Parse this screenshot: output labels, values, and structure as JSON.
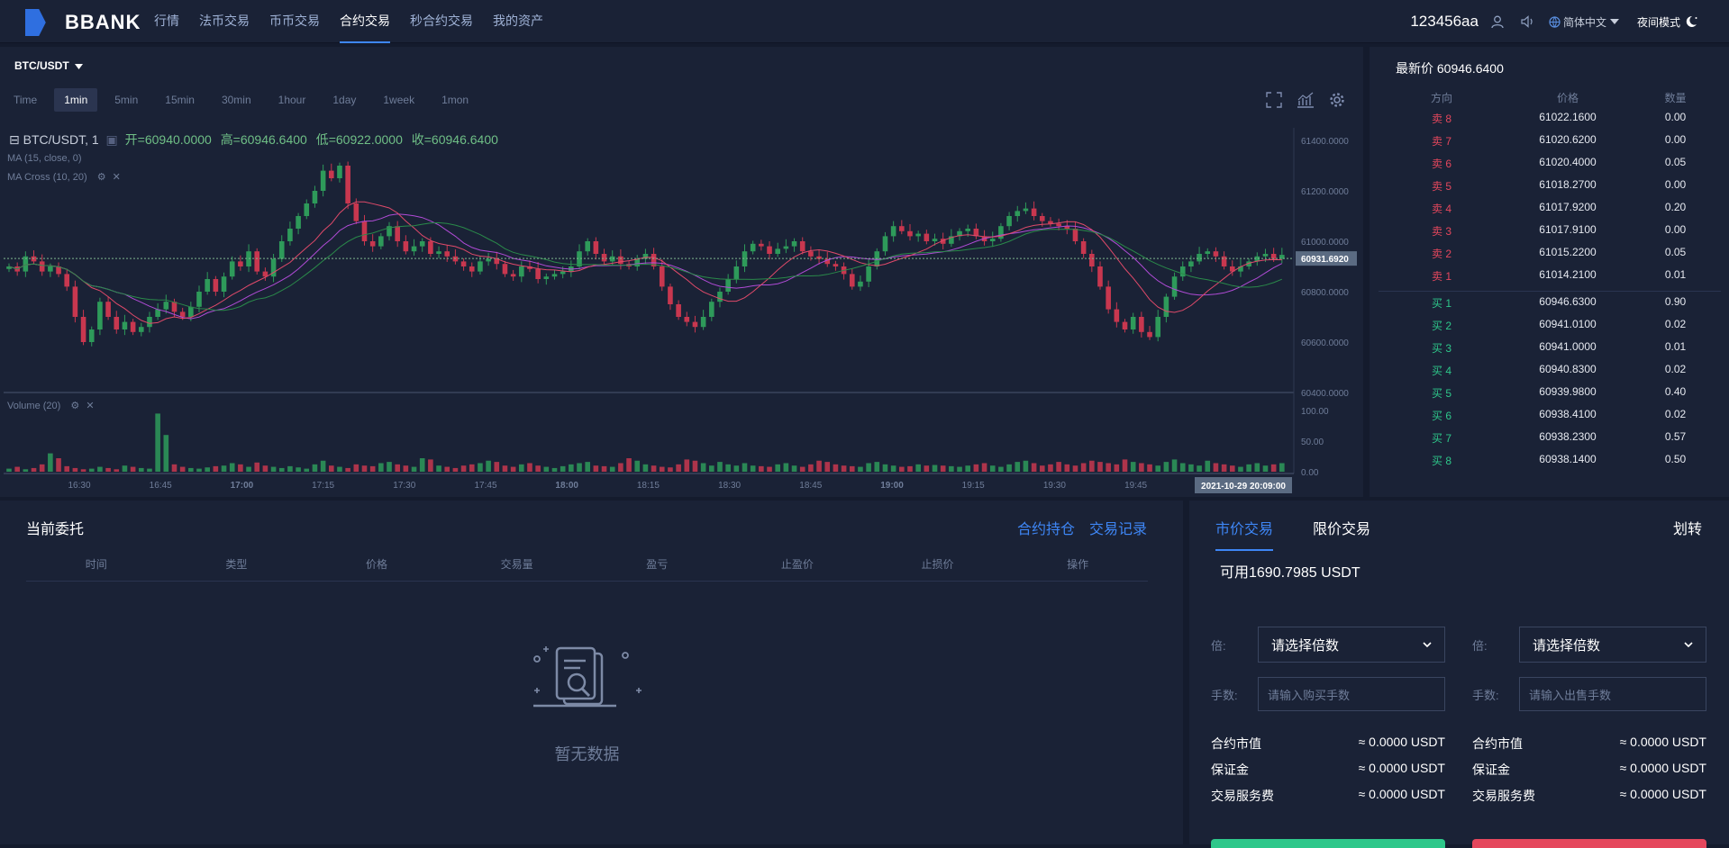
{
  "brand": {
    "logo_text": "BBANK"
  },
  "nav": {
    "items": [
      "行情",
      "法币交易",
      "币币交易",
      "合约交易",
      "秒合约交易",
      "我的资产"
    ],
    "active_index": 3
  },
  "user": {
    "name": "123456aa",
    "language": "简体中文",
    "night_mode": "夜间模式"
  },
  "chart": {
    "pair": "BTC/USDT",
    "periods": [
      "Time",
      "1min",
      "5min",
      "15min",
      "30min",
      "1hour",
      "1day",
      "1week",
      "1mon"
    ],
    "active_period": "1min",
    "ohlc_title": "BTC/USDT, 1",
    "open": "开=60940.0000",
    "high": "高=60946.6400",
    "low": "低=60922.0000",
    "close": "收=60946.6400",
    "ma_label": "MA (15, close, 0)",
    "ma_cross_label": "MA Cross (10, 20)",
    "volume_label": "Volume (20)",
    "price_ticks": [
      "61400.0000",
      "61200.0000",
      "61000.0000",
      "60800.0000",
      "60600.0000",
      "60400.0000"
    ],
    "current_price_label": "60931.6920",
    "volume_ticks": [
      "100.00",
      "50.00",
      "0.00"
    ],
    "time_ticks": [
      "16:30",
      "16:45",
      "17:00",
      "17:15",
      "17:30",
      "17:45",
      "18:00",
      "18:15",
      "18:30",
      "18:45",
      "19:00",
      "19:15",
      "19:30",
      "19:45"
    ],
    "time_cursor": "2021-10-29 20:09:00"
  },
  "chart_data": {
    "type": "candlestick",
    "title": "BTC/USDT, 1",
    "ylim": [
      60400,
      61450
    ],
    "close_series": [
      60900,
      60880,
      60940,
      60920,
      60880,
      60900,
      60870,
      60820,
      60700,
      60600,
      60650,
      60760,
      60700,
      60650,
      60680,
      60640,
      60660,
      60700,
      60730,
      60760,
      60720,
      60700,
      60740,
      60800,
      60850,
      60800,
      60860,
      60920,
      60900,
      60960,
      60880,
      60860,
      60930,
      61000,
      61050,
      61100,
      61150,
      61200,
      61280,
      61250,
      61300,
      61150,
      61080,
      61000,
      60980,
      61020,
      61060,
      61000,
      60960,
      60980,
      61000,
      60950,
      60960,
      60940,
      60920,
      60900,
      60880,
      60920,
      60930,
      60910,
      60870,
      60860,
      60900,
      60890,
      60850,
      60860,
      60870,
      60880,
      60900,
      60960,
      61000,
      60950,
      60920,
      60940,
      60910,
      60900,
      60930,
      60950,
      60900,
      60820,
      60750,
      60700,
      60680,
      60660,
      60700,
      60760,
      60800,
      60850,
      60900,
      60960,
      60990,
      60980,
      60950,
      60970,
      60980,
      61000,
      60960,
      60940,
      60930,
      60910,
      60900,
      60870,
      60820,
      60840,
      60900,
      60960,
      61020,
      61060,
      61040,
      61020,
      61030,
      61000,
      61010,
      60990,
      61020,
      61040,
      61050,
      61020,
      61000,
      61010,
      61060,
      61100,
      61120,
      61130,
      61100,
      61080,
      61070,
      61060,
      61050,
      61000,
      60950,
      60900,
      60820,
      60730,
      60680,
      60650,
      60700,
      60640,
      60620,
      60700,
      60780,
      60860,
      60900,
      60920,
      60950,
      60960,
      60940,
      60900,
      60880,
      60900,
      60920,
      60940,
      60950,
      60930,
      60946
    ],
    "volume_series": [
      5,
      8,
      4,
      6,
      12,
      30,
      22,
      9,
      6,
      4,
      5,
      8,
      6,
      4,
      10,
      8,
      6,
      5,
      95,
      60,
      12,
      8,
      6,
      5,
      7,
      9,
      10,
      14,
      12,
      8,
      15,
      10,
      8,
      6,
      9,
      7,
      5,
      12,
      18,
      10,
      8,
      6,
      12,
      10,
      9,
      14,
      16,
      12,
      10,
      8,
      22,
      20,
      10,
      8,
      6,
      10,
      12,
      14,
      18,
      16,
      10,
      8,
      12,
      14,
      10,
      8,
      6,
      9,
      12,
      14,
      16,
      10,
      9,
      8,
      14,
      22,
      18,
      12,
      10,
      8,
      7,
      12,
      20,
      18,
      14,
      10,
      16,
      12,
      10,
      14,
      10,
      9,
      8,
      12,
      14,
      10,
      8,
      12,
      18,
      16,
      12,
      10,
      9,
      8,
      14,
      16,
      12,
      10,
      8,
      9,
      12,
      10,
      11,
      10,
      9,
      8,
      10,
      12,
      14,
      10,
      8,
      12,
      16,
      18,
      14,
      10,
      12,
      16,
      12,
      10,
      14,
      18,
      16,
      14,
      12,
      20,
      16,
      14,
      12,
      10,
      16,
      20,
      14,
      12,
      10,
      18,
      14,
      12,
      10,
      8,
      12,
      14,
      10,
      12,
      14,
      10,
      12
    ]
  },
  "orderbook": {
    "last_price": "最新价 60946.6400",
    "headers": [
      "方向",
      "价格",
      "数量"
    ],
    "asks": [
      {
        "side": "卖 8",
        "price": "61022.1600",
        "qty": "0.00"
      },
      {
        "side": "卖 7",
        "price": "61020.6200",
        "qty": "0.00"
      },
      {
        "side": "卖 6",
        "price": "61020.4000",
        "qty": "0.05"
      },
      {
        "side": "卖 5",
        "price": "61018.2700",
        "qty": "0.00"
      },
      {
        "side": "卖 4",
        "price": "61017.9200",
        "qty": "0.20"
      },
      {
        "side": "卖 3",
        "price": "61017.9100",
        "qty": "0.00"
      },
      {
        "side": "卖 2",
        "price": "61015.2200",
        "qty": "0.05"
      },
      {
        "side": "卖 1",
        "price": "61014.2100",
        "qty": "0.01"
      }
    ],
    "bids": [
      {
        "side": "买 1",
        "price": "60946.6300",
        "qty": "0.90"
      },
      {
        "side": "买 2",
        "price": "60941.0100",
        "qty": "0.02"
      },
      {
        "side": "买 3",
        "price": "60941.0000",
        "qty": "0.01"
      },
      {
        "side": "买 4",
        "price": "60940.8300",
        "qty": "0.02"
      },
      {
        "side": "买 5",
        "price": "60939.9800",
        "qty": "0.40"
      },
      {
        "side": "买 6",
        "price": "60938.4100",
        "qty": "0.02"
      },
      {
        "side": "买 7",
        "price": "60938.2300",
        "qty": "0.57"
      },
      {
        "side": "买 8",
        "price": "60938.1400",
        "qty": "0.50"
      }
    ]
  },
  "orders": {
    "title": "当前委托",
    "links": [
      "合约持仓",
      "交易记录"
    ],
    "headers": [
      "时间",
      "类型",
      "价格",
      "交易量",
      "盈亏",
      "止盈价",
      "止损价",
      "操作"
    ],
    "empty_text": "暂无数据"
  },
  "trade": {
    "tabs": [
      "市价交易",
      "限价交易"
    ],
    "transfer": "划转",
    "available": "可用1690.7985 USDT",
    "multiplier_label": "倍:",
    "multiplier_placeholder": "请选择倍数",
    "lots_label": "手数:",
    "buy_lots_placeholder": "请输入购买手数",
    "sell_lots_placeholder": "请输入出售手数",
    "contract_value_label": "合约市值",
    "margin_label": "保证金",
    "fee_label": "交易服务费",
    "zero_value": "≈ 0.0000 USDT"
  },
  "colors": {
    "up": "#2e9a5a",
    "down": "#c8374f",
    "accent": "#3e86f5",
    "bg": "#1a2236"
  }
}
